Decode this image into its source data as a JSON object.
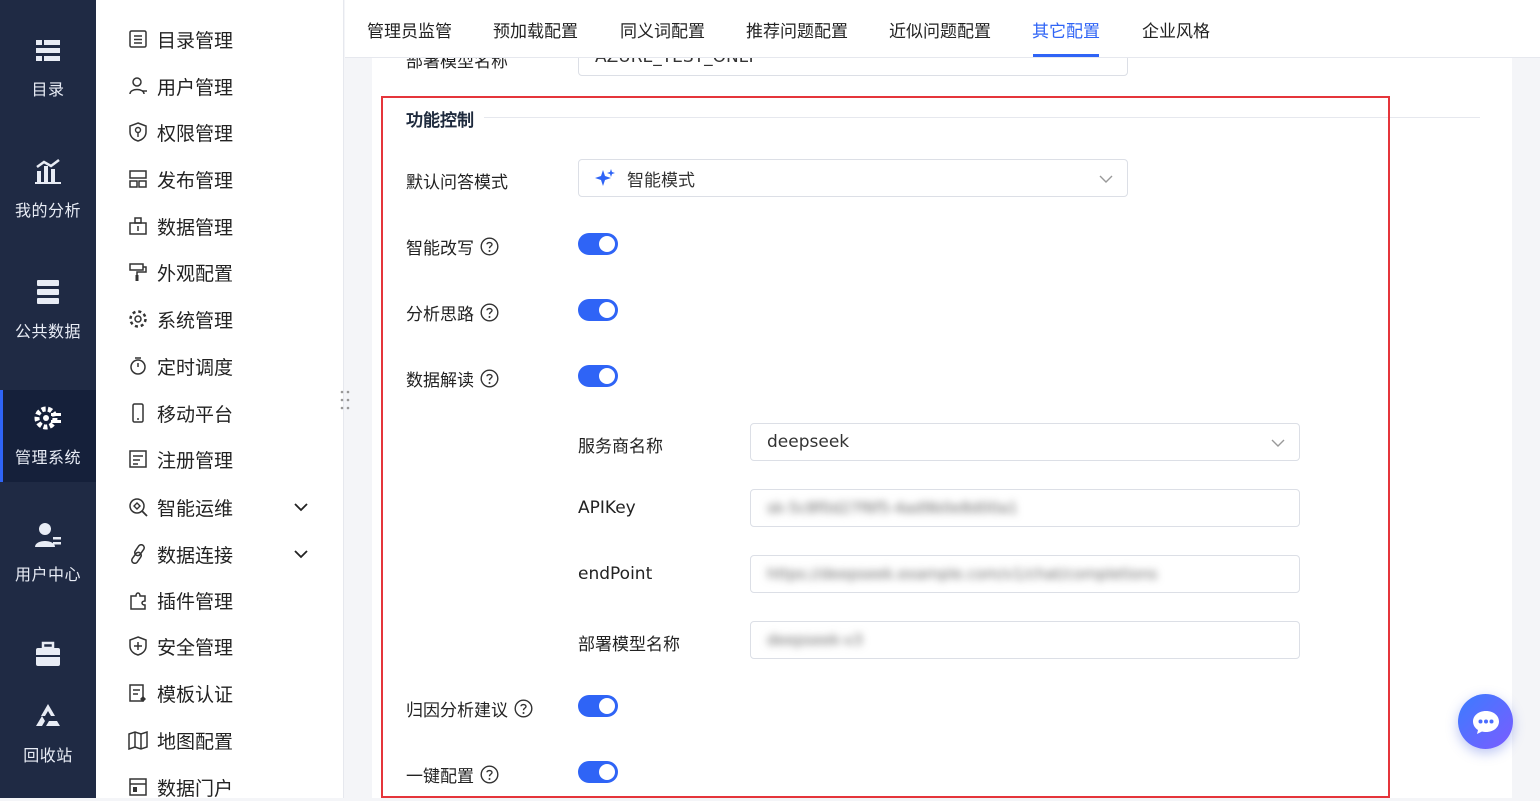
{
  "rail": {
    "items": [
      {
        "label": "目录",
        "icon": "catalog-icon"
      },
      {
        "label": "我的分析",
        "icon": "analysis-icon"
      },
      {
        "label": "公共数据",
        "icon": "database-icon"
      },
      {
        "label": "管理系统",
        "icon": "admin-gear-icon",
        "active": true
      },
      {
        "label": "用户中心",
        "icon": "user-center-icon"
      },
      {
        "label": "回收站",
        "icon": "recycle-icon"
      }
    ]
  },
  "menu": {
    "items": [
      {
        "label": "目录管理",
        "icon": "list-icon"
      },
      {
        "label": "用户管理",
        "icon": "user-icon"
      },
      {
        "label": "权限管理",
        "icon": "shield-key-icon"
      },
      {
        "label": "发布管理",
        "icon": "publish-icon"
      },
      {
        "label": "数据管理",
        "icon": "data-box-icon"
      },
      {
        "label": "外观配置",
        "icon": "paint-roller-icon"
      },
      {
        "label": "系统管理",
        "icon": "gear-icon"
      },
      {
        "label": "定时调度",
        "icon": "timer-icon"
      },
      {
        "label": "移动平台",
        "icon": "mobile-icon"
      },
      {
        "label": "注册管理",
        "icon": "register-icon"
      },
      {
        "label": "智能运维",
        "icon": "ops-icon",
        "expandable": true
      },
      {
        "label": "数据连接",
        "icon": "link-icon",
        "expandable": true
      },
      {
        "label": "插件管理",
        "icon": "plugin-icon"
      },
      {
        "label": "安全管理",
        "icon": "shield-plus-icon"
      },
      {
        "label": "模板认证",
        "icon": "template-icon"
      },
      {
        "label": "地图配置",
        "icon": "map-icon"
      },
      {
        "label": "数据门户",
        "icon": "portal-icon"
      }
    ]
  },
  "tabs": [
    {
      "label": "管理员监管"
    },
    {
      "label": "预加载配置"
    },
    {
      "label": "同义词配置"
    },
    {
      "label": "推荐问题配置"
    },
    {
      "label": "近似问题配置"
    },
    {
      "label": "其它配置",
      "active": true
    },
    {
      "label": "企业风格"
    }
  ],
  "top_partial": {
    "label": "部署模型名称",
    "value": "AZURE_TEST_ONLY"
  },
  "section": {
    "title": "功能控制",
    "default_mode_label": "默认问答模式",
    "default_mode_value": "智能模式",
    "toggles": [
      {
        "label": "智能改写",
        "on": true
      },
      {
        "label": "分析思路",
        "on": true
      },
      {
        "label": "数据解读",
        "on": true
      },
      {
        "label": "归因分析建议",
        "on": true
      },
      {
        "label": "一键配置",
        "on": true
      }
    ],
    "sub": {
      "provider_label": "服务商名称",
      "provider_value": "deepseek",
      "apikey_label": "APIKey",
      "apikey_value": "sk-5c8f0d27f6f5-4ad9b0e8d00a1",
      "endpoint_label": "endPoint",
      "endpoint_value": "https://deepseek.example.com/v1/chat/completions",
      "model_label": "部署模型名称",
      "model_value": "deepseek-v3"
    }
  },
  "colors": {
    "accent": "#2f64f6",
    "rail_bg": "#1f2a44",
    "highlight": "#e5353b"
  }
}
